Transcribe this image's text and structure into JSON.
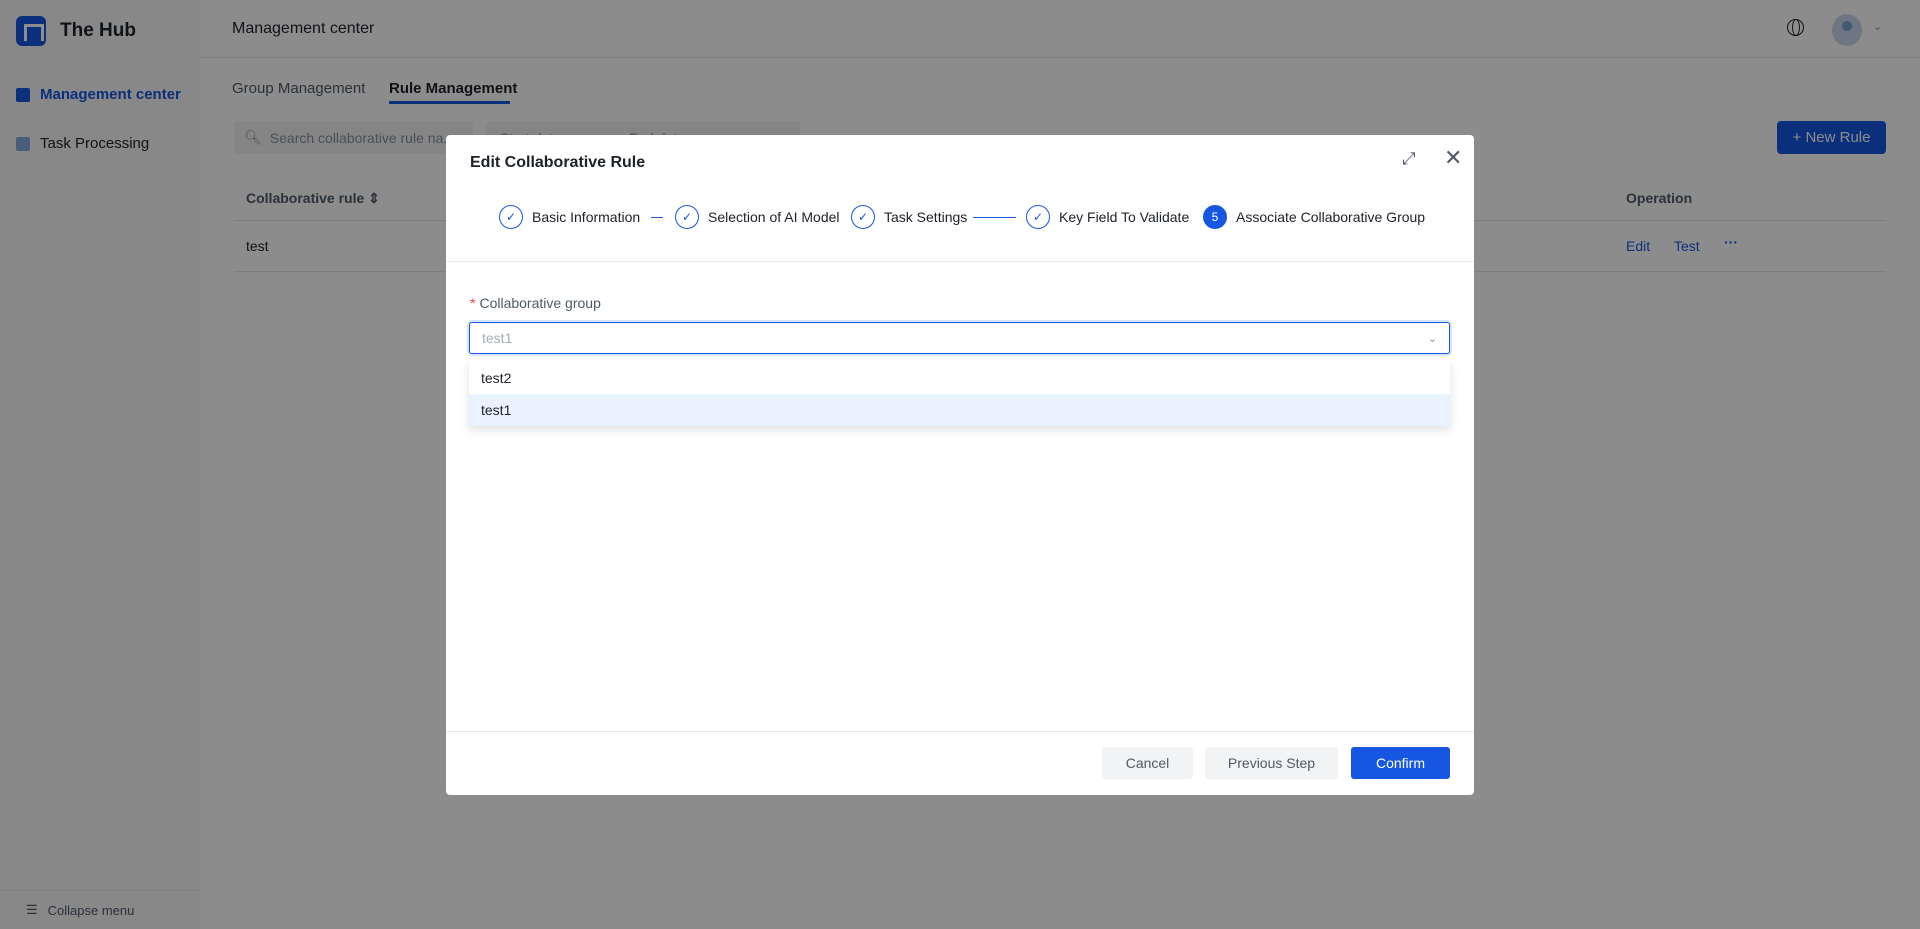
{
  "app": {
    "brand": "The Hub",
    "header_title": "Management center"
  },
  "sidebar": {
    "items": [
      {
        "label": "Management center",
        "active": true
      },
      {
        "label": "Task Processing",
        "active": false
      }
    ],
    "collapse": "Collapse menu"
  },
  "tabs": [
    {
      "label": "Group Management"
    },
    {
      "label": "Rule Management",
      "active": true
    }
  ],
  "toolbar": {
    "search_placeholder": "Search collaborative rule na...",
    "date_start": "Start date",
    "date_end": "End date",
    "new_rule": "+ New Rule"
  },
  "table": {
    "columns": [
      "Collaborative rule",
      "Operation"
    ],
    "rows": [
      {
        "rule": "test",
        "actions": [
          "Edit",
          "Test",
          "···"
        ]
      }
    ]
  },
  "modal": {
    "title": "Edit Collaborative Rule",
    "steps": [
      {
        "label": "Basic Information",
        "status": "done"
      },
      {
        "label": "Selection of AI Model",
        "status": "done"
      },
      {
        "label": "Task Settings",
        "status": "done"
      },
      {
        "label": "Key Field To Validate",
        "status": "done"
      },
      {
        "label": "Associate Collaborative Group",
        "status": "current",
        "number": "5"
      }
    ],
    "field_label": "Collaborative group",
    "required_mark": "*",
    "select_value": "test1",
    "options": [
      {
        "label": "test2"
      },
      {
        "label": "test1",
        "selected": true
      }
    ],
    "buttons": {
      "cancel": "Cancel",
      "previous": "Previous Step",
      "confirm": "Confirm"
    }
  },
  "colors": {
    "accent": "#1656e0",
    "overlay": "rgba(0,0,0,0.45)"
  }
}
